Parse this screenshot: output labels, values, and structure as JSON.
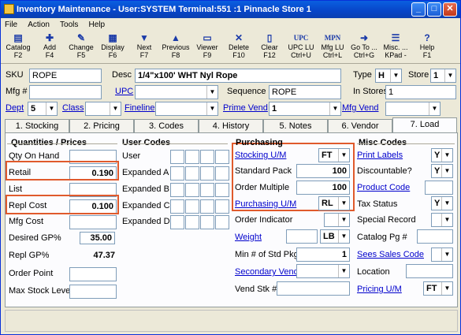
{
  "window": {
    "title": "Inventory Maintenance - User:SYSTEM Terminal:551 :1 Pinnacle Store 1"
  },
  "menu": [
    "File",
    "Action",
    "Tools",
    "Help"
  ],
  "toolbar": [
    {
      "label": "Catalog",
      "key": "F2",
      "icon": "catalog-icon",
      "glyph": "▤"
    },
    {
      "label": "Add",
      "key": "F4",
      "icon": "add-icon",
      "glyph": "✚"
    },
    {
      "label": "Change",
      "key": "F5",
      "icon": "change-icon",
      "glyph": "✎"
    },
    {
      "label": "Display",
      "key": "F6",
      "icon": "display-icon",
      "glyph": "▦"
    },
    {
      "label": "Next",
      "key": "F7",
      "icon": "arrow-down-icon",
      "glyph": "▼"
    },
    {
      "label": "Previous",
      "key": "F8",
      "icon": "arrow-up-icon",
      "glyph": "▲"
    },
    {
      "label": "Viewer",
      "key": "F9",
      "icon": "viewer-icon",
      "glyph": "▭"
    },
    {
      "label": "Delete",
      "key": "F10",
      "icon": "delete-icon",
      "glyph": "✕"
    },
    {
      "label": "Clear",
      "key": "F12",
      "icon": "clear-icon",
      "glyph": "▯"
    },
    {
      "label": "UPC LU",
      "key": "Ctrl+U",
      "icon": "upc-icon",
      "glyph": "UPC"
    },
    {
      "label": "Mfg LU",
      "key": "Ctrl+L",
      "icon": "mpn-icon",
      "glyph": "MPN"
    },
    {
      "label": "Go To ...",
      "key": "Ctrl+G",
      "icon": "goto-icon",
      "glyph": "➜"
    },
    {
      "label": "Misc. ...",
      "key": "KPad -",
      "icon": "misc-icon",
      "glyph": "☰"
    },
    {
      "label": "Help",
      "key": "F1",
      "icon": "help-icon",
      "glyph": "?"
    }
  ],
  "header": {
    "sku_label": "SKU",
    "sku": "ROPE",
    "desc_label": "Desc",
    "desc": "1/4\"x100' WHT Nyl Rope",
    "type_label": "Type",
    "type": "H",
    "store_label": "Store",
    "store": "1",
    "mfg_label": "Mfg #",
    "mfg": "",
    "upc_label": "UPC",
    "upc": "",
    "seq_label": "Sequence",
    "sequence": "ROPE",
    "instores_label": "In Stores",
    "instores": "1",
    "dept_label": "Dept",
    "dept": "5",
    "class_label": "Class",
    "class": "",
    "fineline_label": "Fineline",
    "fineline": "",
    "primevend_label": "Prime Vend",
    "primevend": "1",
    "mfgvend_label": "Mfg Vend",
    "mfgvend": ""
  },
  "tabs": [
    "1. Stocking",
    "2. Pricing",
    "3. Codes",
    "4. History",
    "5. Notes",
    "6. Vendor",
    "7. Load"
  ],
  "qty": {
    "title": "Quantities / Prices",
    "rows": [
      {
        "label": "Qty On Hand",
        "value": ""
      },
      {
        "label": "Retail",
        "value": "0.190"
      },
      {
        "label": "List",
        "value": ""
      },
      {
        "label": "Repl Cost",
        "value": "0.100"
      },
      {
        "label": "Mfg Cost",
        "value": ""
      },
      {
        "label": "Desired GP%",
        "value": "35.00"
      },
      {
        "label": "Repl GP%",
        "value": "47.37"
      },
      {
        "label": "Order Point",
        "value": ""
      },
      {
        "label": "Max Stock Level",
        "value": ""
      }
    ]
  },
  "usercodes": {
    "title": "User Codes",
    "rows": [
      "User",
      "Expanded A",
      "Expanded B",
      "Expanded C",
      "Expanded D"
    ]
  },
  "purch": {
    "title": "Purchasing",
    "stocking_um_label": "Stocking U/M",
    "stocking_um": "FT",
    "std_pack_label": "Standard Pack",
    "std_pack": "100",
    "order_mult_label": "Order Multiple",
    "order_mult": "100",
    "purch_um_label": "Purchasing U/M",
    "purch_um": "RL",
    "order_ind_label": "Order Indicator",
    "order_ind": "",
    "weight_label": "Weight",
    "weight": "",
    "weight_unit": "LB",
    "min_pkgs_label": "Min # of Std Pkgs",
    "min_pkgs": "1",
    "sec_vend_label": "Secondary Vend",
    "sec_vend": "",
    "vend_stk_label": "Vend Stk #",
    "vend_stk": ""
  },
  "misc": {
    "title": "Misc Codes",
    "print_labels_label": "Print Labels",
    "print_labels": "Y",
    "discountable_label": "Discountable?",
    "discountable": "Y",
    "product_code_label": "Product Code",
    "product_code": "",
    "tax_status_label": "Tax Status",
    "tax_status": "Y",
    "special_record_label": "Special Record",
    "special_record": "",
    "catalog_pg_label": "Catalog Pg #",
    "catalog_pg": "",
    "sees_sales_label": "Sees Sales Code",
    "sees_sales": "",
    "location_label": "Location",
    "location": "",
    "pricing_um_label": "Pricing U/M",
    "pricing_um": "FT"
  },
  "colors": {
    "highlight": "#e05a2c",
    "title_bar": "#0745c8",
    "link": "#0000cc"
  }
}
